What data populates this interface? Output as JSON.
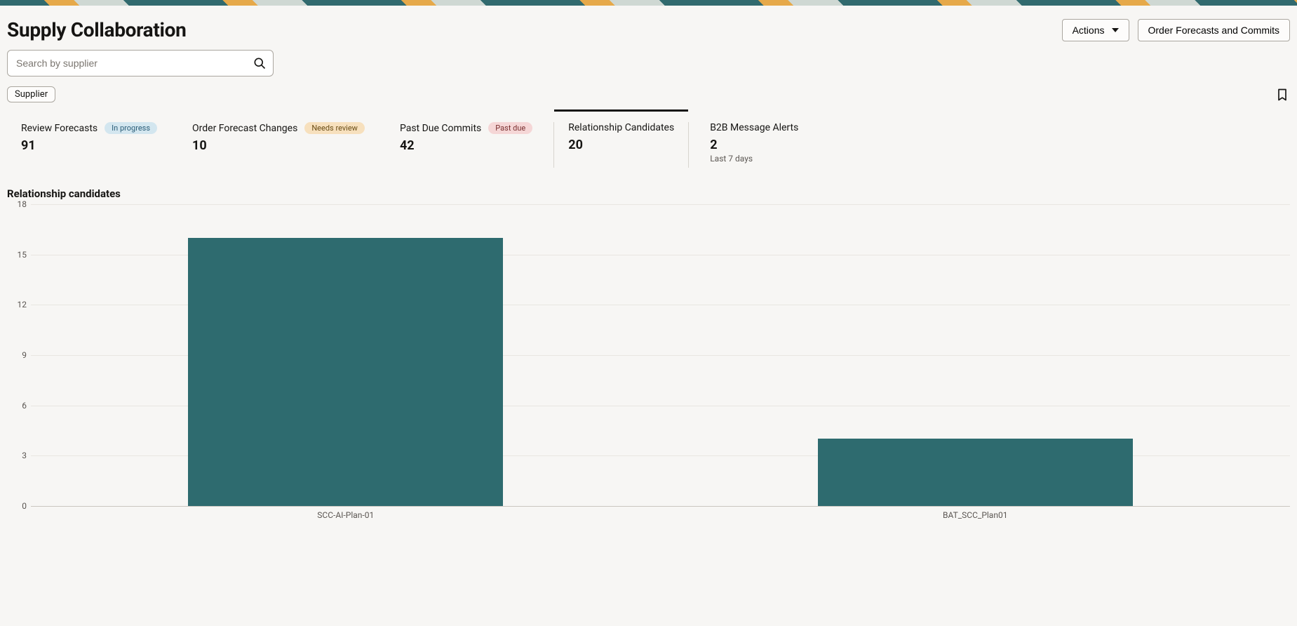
{
  "decor": true,
  "header": {
    "title": "Supply Collaboration",
    "actions_label": "Actions",
    "order_button_label": "Order Forecasts and Commits"
  },
  "search": {
    "placeholder": "Search by supplier",
    "value": ""
  },
  "filters": {
    "supplier_chip_label": "Supplier"
  },
  "cards": [
    {
      "id": "review-forecasts",
      "label": "Review Forecasts",
      "value": "91",
      "pill": {
        "text": "In progress",
        "style": "blue"
      }
    },
    {
      "id": "order-forecast-changes",
      "label": "Order Forecast Changes",
      "value": "10",
      "pill": {
        "text": "Needs review",
        "style": "yellow"
      }
    },
    {
      "id": "past-due-commits",
      "label": "Past Due Commits",
      "value": "42",
      "pill": {
        "text": "Past due",
        "style": "red"
      }
    },
    {
      "id": "relationship-candidates",
      "label": "Relationship Candidates",
      "value": "20",
      "selected": true
    },
    {
      "id": "b2b-message-alerts",
      "label": "B2B Message Alerts",
      "value": "2",
      "sub": "Last 7 days"
    }
  ],
  "section": {
    "title": "Relationship candidates"
  },
  "chart_data": {
    "type": "bar",
    "title": "Relationship candidates",
    "xlabel": "",
    "ylabel": "",
    "ylim": [
      0,
      18
    ],
    "y_ticks": [
      0,
      3,
      6,
      9,
      12,
      15,
      18
    ],
    "categories": [
      "SCC-AI-Plan-01",
      "BAT_SCC_Plan01"
    ],
    "values": [
      16,
      4
    ],
    "bar_color": "#2e6b6f"
  }
}
